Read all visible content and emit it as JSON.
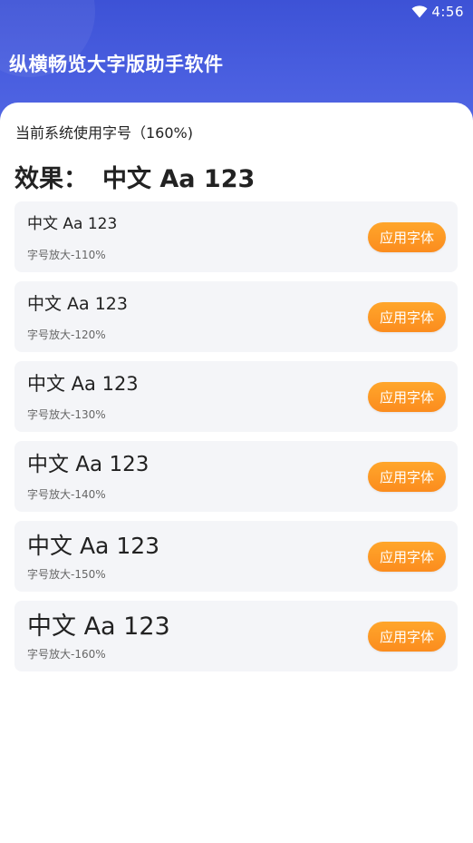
{
  "status_bar": {
    "time": "4:56"
  },
  "header": {
    "title": "纵横畅览大字版助手软件"
  },
  "main": {
    "system_font_size_label": "当前系统使用字号（160%)",
    "effect_label": "效果：",
    "effect_sample": "中文  Aa 123",
    "options": [
      {
        "sample": "中文 Aa 123",
        "caption": "字号放大-110%",
        "button": "应用字体",
        "scale": 1.1
      },
      {
        "sample": "中文 Aa 123",
        "caption": "字号放大-120%",
        "button": "应用字体",
        "scale": 1.2
      },
      {
        "sample": "中文 Aa 123",
        "caption": "字号放大-130%",
        "button": "应用字体",
        "scale": 1.3
      },
      {
        "sample": "中文 Aa 123",
        "caption": "字号放大-140%",
        "button": "应用字体",
        "scale": 1.4
      },
      {
        "sample": "中文 Aa 123",
        "caption": "字号放大-150%",
        "button": "应用字体",
        "scale": 1.5
      },
      {
        "sample": "中文 Aa 123",
        "caption": "字号放大-160%",
        "button": "应用字体",
        "scale": 1.6
      }
    ]
  },
  "colors": {
    "header_blue": "#4a5fe0",
    "button_orange": "#fb8c1e",
    "card_bg": "#f4f5f8"
  }
}
